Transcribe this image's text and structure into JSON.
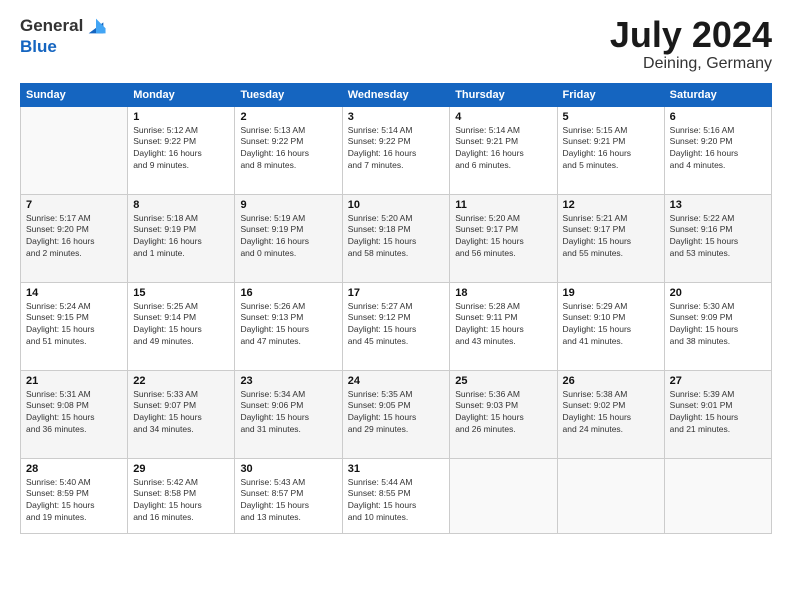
{
  "header": {
    "logo_general": "General",
    "logo_blue": "Blue",
    "month_year": "July 2024",
    "location": "Deining, Germany"
  },
  "weekdays": [
    "Sunday",
    "Monday",
    "Tuesday",
    "Wednesday",
    "Thursday",
    "Friday",
    "Saturday"
  ],
  "weeks": [
    [
      {
        "day": "",
        "info": ""
      },
      {
        "day": "1",
        "info": "Sunrise: 5:12 AM\nSunset: 9:22 PM\nDaylight: 16 hours\nand 9 minutes."
      },
      {
        "day": "2",
        "info": "Sunrise: 5:13 AM\nSunset: 9:22 PM\nDaylight: 16 hours\nand 8 minutes."
      },
      {
        "day": "3",
        "info": "Sunrise: 5:14 AM\nSunset: 9:22 PM\nDaylight: 16 hours\nand 7 minutes."
      },
      {
        "day": "4",
        "info": "Sunrise: 5:14 AM\nSunset: 9:21 PM\nDaylight: 16 hours\nand 6 minutes."
      },
      {
        "day": "5",
        "info": "Sunrise: 5:15 AM\nSunset: 9:21 PM\nDaylight: 16 hours\nand 5 minutes."
      },
      {
        "day": "6",
        "info": "Sunrise: 5:16 AM\nSunset: 9:20 PM\nDaylight: 16 hours\nand 4 minutes."
      }
    ],
    [
      {
        "day": "7",
        "info": "Sunrise: 5:17 AM\nSunset: 9:20 PM\nDaylight: 16 hours\nand 2 minutes."
      },
      {
        "day": "8",
        "info": "Sunrise: 5:18 AM\nSunset: 9:19 PM\nDaylight: 16 hours\nand 1 minute."
      },
      {
        "day": "9",
        "info": "Sunrise: 5:19 AM\nSunset: 9:19 PM\nDaylight: 16 hours\nand 0 minutes."
      },
      {
        "day": "10",
        "info": "Sunrise: 5:20 AM\nSunset: 9:18 PM\nDaylight: 15 hours\nand 58 minutes."
      },
      {
        "day": "11",
        "info": "Sunrise: 5:20 AM\nSunset: 9:17 PM\nDaylight: 15 hours\nand 56 minutes."
      },
      {
        "day": "12",
        "info": "Sunrise: 5:21 AM\nSunset: 9:17 PM\nDaylight: 15 hours\nand 55 minutes."
      },
      {
        "day": "13",
        "info": "Sunrise: 5:22 AM\nSunset: 9:16 PM\nDaylight: 15 hours\nand 53 minutes."
      }
    ],
    [
      {
        "day": "14",
        "info": "Sunrise: 5:24 AM\nSunset: 9:15 PM\nDaylight: 15 hours\nand 51 minutes."
      },
      {
        "day": "15",
        "info": "Sunrise: 5:25 AM\nSunset: 9:14 PM\nDaylight: 15 hours\nand 49 minutes."
      },
      {
        "day": "16",
        "info": "Sunrise: 5:26 AM\nSunset: 9:13 PM\nDaylight: 15 hours\nand 47 minutes."
      },
      {
        "day": "17",
        "info": "Sunrise: 5:27 AM\nSunset: 9:12 PM\nDaylight: 15 hours\nand 45 minutes."
      },
      {
        "day": "18",
        "info": "Sunrise: 5:28 AM\nSunset: 9:11 PM\nDaylight: 15 hours\nand 43 minutes."
      },
      {
        "day": "19",
        "info": "Sunrise: 5:29 AM\nSunset: 9:10 PM\nDaylight: 15 hours\nand 41 minutes."
      },
      {
        "day": "20",
        "info": "Sunrise: 5:30 AM\nSunset: 9:09 PM\nDaylight: 15 hours\nand 38 minutes."
      }
    ],
    [
      {
        "day": "21",
        "info": "Sunrise: 5:31 AM\nSunset: 9:08 PM\nDaylight: 15 hours\nand 36 minutes."
      },
      {
        "day": "22",
        "info": "Sunrise: 5:33 AM\nSunset: 9:07 PM\nDaylight: 15 hours\nand 34 minutes."
      },
      {
        "day": "23",
        "info": "Sunrise: 5:34 AM\nSunset: 9:06 PM\nDaylight: 15 hours\nand 31 minutes."
      },
      {
        "day": "24",
        "info": "Sunrise: 5:35 AM\nSunset: 9:05 PM\nDaylight: 15 hours\nand 29 minutes."
      },
      {
        "day": "25",
        "info": "Sunrise: 5:36 AM\nSunset: 9:03 PM\nDaylight: 15 hours\nand 26 minutes."
      },
      {
        "day": "26",
        "info": "Sunrise: 5:38 AM\nSunset: 9:02 PM\nDaylight: 15 hours\nand 24 minutes."
      },
      {
        "day": "27",
        "info": "Sunrise: 5:39 AM\nSunset: 9:01 PM\nDaylight: 15 hours\nand 21 minutes."
      }
    ],
    [
      {
        "day": "28",
        "info": "Sunrise: 5:40 AM\nSunset: 8:59 PM\nDaylight: 15 hours\nand 19 minutes."
      },
      {
        "day": "29",
        "info": "Sunrise: 5:42 AM\nSunset: 8:58 PM\nDaylight: 15 hours\nand 16 minutes."
      },
      {
        "day": "30",
        "info": "Sunrise: 5:43 AM\nSunset: 8:57 PM\nDaylight: 15 hours\nand 13 minutes."
      },
      {
        "day": "31",
        "info": "Sunrise: 5:44 AM\nSunset: 8:55 PM\nDaylight: 15 hours\nand 10 minutes."
      },
      {
        "day": "",
        "info": ""
      },
      {
        "day": "",
        "info": ""
      },
      {
        "day": "",
        "info": ""
      }
    ]
  ]
}
